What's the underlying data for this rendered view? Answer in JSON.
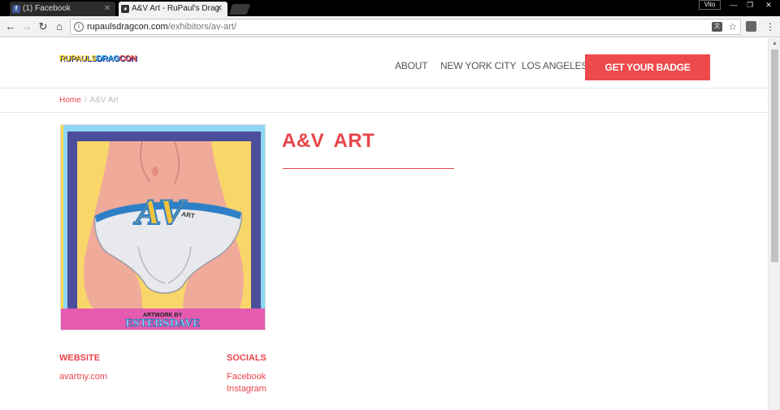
{
  "browser": {
    "tabs": [
      {
        "title": "(1) Facebook",
        "favicon": "f",
        "favicon_color": "#3b5998",
        "active": false
      },
      {
        "title": "A&V Art - RuPaul's Drag",
        "favicon": "◕",
        "favicon_color": "#333333",
        "active": true
      }
    ],
    "profile_name": "Vito",
    "url_host": "rupaulsdragcon.com",
    "url_path": "/exhibitors/av-art/"
  },
  "site": {
    "logo": {
      "part1": "RUPAULS",
      "part2": "DRAG",
      "part3": "CON"
    },
    "nav": [
      "ABOUT",
      "NEW YORK CITY",
      "LOS ANGELES"
    ],
    "cta": "GET YOUR BADGE",
    "accent_color": "#ee4a4d"
  },
  "breadcrumb": {
    "home": "Home",
    "separator": "/",
    "current": "A&V Art"
  },
  "exhibitor": {
    "name": "A&V  ART",
    "artwork": {
      "brand_text": "AV",
      "small_text": "ART",
      "caption_top": "ARTWORK BY",
      "caption_bottom": "ESTEBSDAVE"
    }
  },
  "website": {
    "heading": "WEBSITE",
    "link": "avartny.com"
  },
  "socials": {
    "heading": "SOCIALS",
    "links": [
      "Facebook",
      "Instagram"
    ]
  }
}
